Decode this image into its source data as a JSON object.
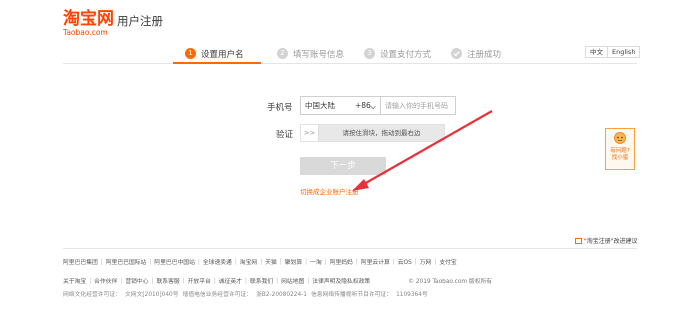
{
  "header": {
    "logo_text": "淘宝网",
    "logo_sub": "Taobao.com",
    "page_title": "用户注册"
  },
  "steps": [
    {
      "num": "1",
      "label": "设置用户名",
      "active": true
    },
    {
      "num": "2",
      "label": "填写账号信息",
      "active": false
    },
    {
      "num": "3",
      "label": "设置支付方式",
      "active": false
    },
    {
      "num": "",
      "label": "注册成功",
      "active": false
    }
  ],
  "language": {
    "zh": "中文",
    "en": "English"
  },
  "form": {
    "phone_label": "手机号",
    "country": "中国大陆",
    "country_code": "+86",
    "phone_placeholder": "请输入你的手机号码",
    "verify_label": "验证",
    "slider_handle": ">>",
    "slider_text": "请按住滑块，拖动到最右边",
    "next_button": "下一步",
    "enterprise_link": "切换成企业账户注册"
  },
  "feedback": {
    "line1": "有问题?",
    "line2": "找小蜜"
  },
  "reg_advice": "\"淘宝注册\"改进建议",
  "footer": {
    "row1": [
      "阿里巴巴集团",
      "阿里巴巴国际站",
      "阿里巴巴中国站",
      "全球速卖通",
      "淘宝网",
      "天猫",
      "聚划算",
      "一淘",
      "阿里妈妈",
      "阿里云计算",
      "云OS",
      "万网",
      "支付宝"
    ],
    "row2": [
      "关于淘宝",
      "合作伙伴",
      "营销中心",
      "联系客服",
      "开放平台",
      "诚征英才",
      "联系我们",
      "网站地图",
      "法律声明及隐私权政策"
    ],
    "copyright": "© 2019 Taobao.com 版权所有",
    "row3": [
      "网络文化经营许可证：",
      "文网文[2010]040号",
      "增值电信业务经营许可证：",
      "浙B2-20080224-1",
      "信息网络传播视听节目许可证：",
      "1109364号"
    ]
  },
  "colors": {
    "accent": "#ff6a00",
    "brand": "#ff4400",
    "arrow": "#e8303a"
  }
}
